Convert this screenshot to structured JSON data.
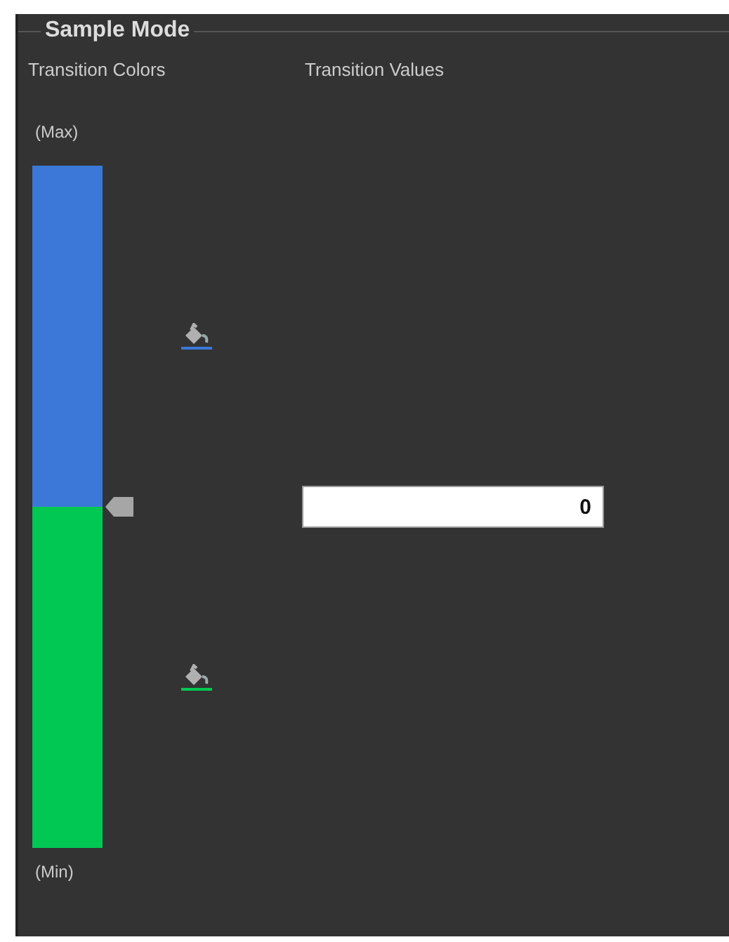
{
  "group": {
    "title": "Sample Mode"
  },
  "headers": {
    "colors": "Transition Colors",
    "values": "Transition Values"
  },
  "max_label": "(Max)",
  "min_label": "(Min)",
  "bands": [
    {
      "color": "#3b78d8"
    },
    {
      "color": "#00c853"
    }
  ],
  "transitions": [
    {
      "value": "0"
    }
  ]
}
